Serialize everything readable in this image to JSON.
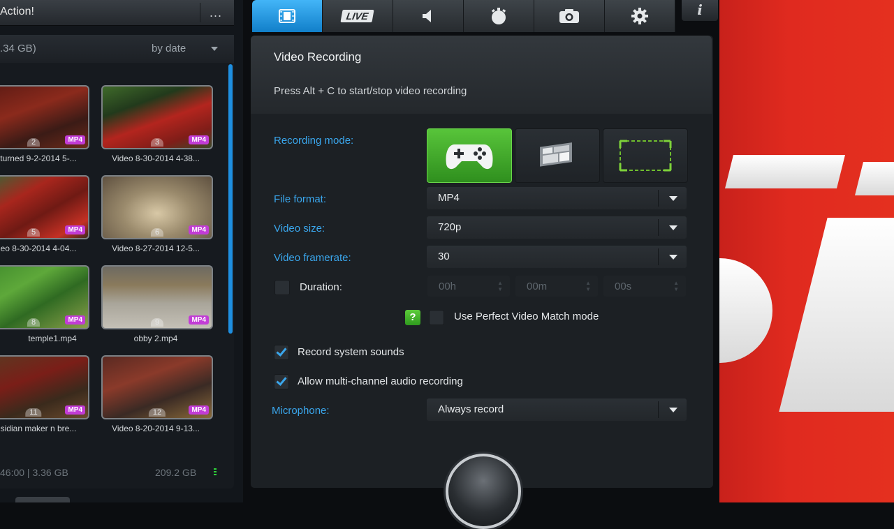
{
  "app": {
    "title": "Action!"
  },
  "left": {
    "more_label": "...",
    "storage": ".34 GB)",
    "sort": "by date",
    "items": [
      {
        "name": "turned 9-2-2014 5-...",
        "num": "2",
        "format": "MP4"
      },
      {
        "name": "Video 8-30-2014 4-38...",
        "num": "3",
        "format": "MP4"
      },
      {
        "name": "eo 8-30-2014 4-04...",
        "num": "5",
        "format": "MP4"
      },
      {
        "name": "Video 8-27-2014 12-5...",
        "num": "6",
        "format": "MP4"
      },
      {
        "name": "temple1.mp4",
        "num": "8",
        "format": "MP4"
      },
      {
        "name": "obby 2.mp4",
        "num": "9",
        "format": "MP4"
      },
      {
        "name": "sidian maker n bre...",
        "num": "11",
        "format": "MP4"
      },
      {
        "name": "Video 8-20-2014 9-13...",
        "num": "12",
        "format": "MP4"
      }
    ],
    "footer_duration": "46:00 | 3.36 GB",
    "footer_free": "209.2 GB"
  },
  "tabs": [
    {
      "name": "video-tab",
      "icon": "film-icon"
    },
    {
      "name": "live-tab",
      "label": "LIVE"
    },
    {
      "name": "audio-tab",
      "icon": "speaker-icon"
    },
    {
      "name": "benchmark-tab",
      "icon": "stopwatch-icon"
    },
    {
      "name": "screenshot-tab",
      "icon": "camera-icon"
    },
    {
      "name": "settings-tab",
      "icon": "gear-icon"
    }
  ],
  "info_label": "i",
  "settings": {
    "title": "Video Recording",
    "hint": "Press Alt + C to start/stop video recording",
    "recording_mode_label": "Recording mode:",
    "file_format_label": "File format:",
    "file_format": "MP4",
    "video_size_label": "Video size:",
    "video_size": "720p",
    "framerate_label": "Video framerate:",
    "framerate": "30",
    "duration_label": "Duration:",
    "duration_h": "00h",
    "duration_m": "00m",
    "duration_s": "00s",
    "help_label": "?",
    "perfect_match_label": "Use Perfect Video Match mode",
    "system_sounds_label": "Record system sounds",
    "multichannel_label": "Allow multi-channel audio recording",
    "microphone_label": "Microphone:",
    "microphone": "Always record"
  },
  "colors": {
    "accent": "#3aa6ec",
    "active_mode": "#4cb432",
    "format_badge": "#c23cd6",
    "background_red": "#e02a1f"
  }
}
